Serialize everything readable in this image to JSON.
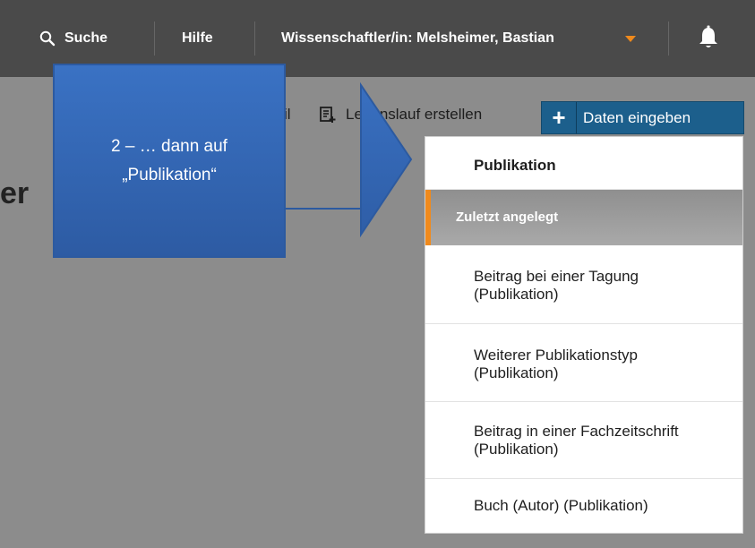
{
  "topbar": {
    "search_label": "Suche",
    "help_label": "Hilfe",
    "user_label": "Wissenschaftler/in: Melsheimer, Bastian",
    "accent": "#f08a1c"
  },
  "page": {
    "heading_fragment": "er",
    "profile_fragment": "il",
    "cv_link_label": "Lebenslauf erstellen",
    "enter_data_plus": "+",
    "enter_data_label": "Daten eingeben"
  },
  "menu": {
    "header": "Publikation",
    "section_label": "Zuletzt angelegt",
    "items": [
      {
        "line1": "Beitrag bei einer Tagung",
        "line2": "(Publikation)"
      },
      {
        "line1": "Weiterer Publikationstyp",
        "line2": "(Publikation)"
      },
      {
        "line1": "Beitrag in einer Fachzeitschrift",
        "line2": "(Publikation)"
      },
      {
        "line1": "Buch (Autor) (Publikation)",
        "line2": ""
      }
    ]
  },
  "callout": {
    "line1": "2 – … dann auf",
    "line2": "„Publikation“",
    "color": "#3467b8"
  }
}
